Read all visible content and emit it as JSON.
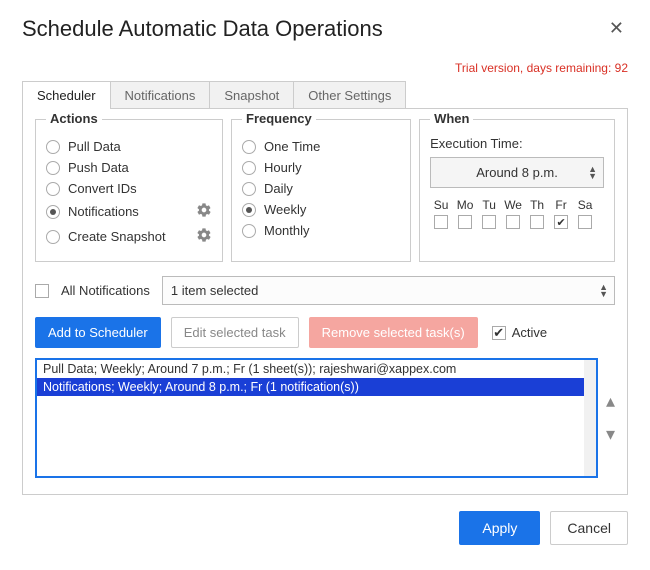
{
  "dialog": {
    "title": "Schedule Automatic Data Operations",
    "trial_notice": "Trial version, days remaining: 92"
  },
  "tabs": [
    "Scheduler",
    "Notifications",
    "Snapshot",
    "Other Settings"
  ],
  "active_tab": 0,
  "groups": {
    "actions": {
      "legend": "Actions",
      "items": [
        "Pull Data",
        "Push Data",
        "Convert IDs",
        "Notifications",
        "Create Snapshot"
      ],
      "selected": 3,
      "gear_indices": [
        3,
        4
      ]
    },
    "frequency": {
      "legend": "Frequency",
      "items": [
        "One Time",
        "Hourly",
        "Daily",
        "Weekly",
        "Monthly"
      ],
      "selected": 3
    },
    "when": {
      "legend": "When",
      "execution_label": "Execution Time:",
      "time_value": "Around 8 p.m.",
      "days": [
        "Su",
        "Mo",
        "Tu",
        "We",
        "Th",
        "Fr",
        "Sa"
      ],
      "checked_days": [
        "Fr"
      ]
    }
  },
  "notif_filter": {
    "all_label": "All Notifications",
    "all_checked": false,
    "selected_text": "1 item selected"
  },
  "buttons": {
    "add": "Add to Scheduler",
    "edit": "Edit selected task",
    "remove": "Remove selected task(s)",
    "active_label": "Active",
    "active_checked": true,
    "apply": "Apply",
    "cancel": "Cancel"
  },
  "tasks": [
    {
      "text": "Pull Data; Weekly; Around 7 p.m.; Fr (1 sheet(s)); rajeshwari@xappex.com",
      "selected": false
    },
    {
      "text": "Notifications; Weekly; Around 8 p.m.; Fr (1 notification(s))",
      "selected": true
    }
  ]
}
